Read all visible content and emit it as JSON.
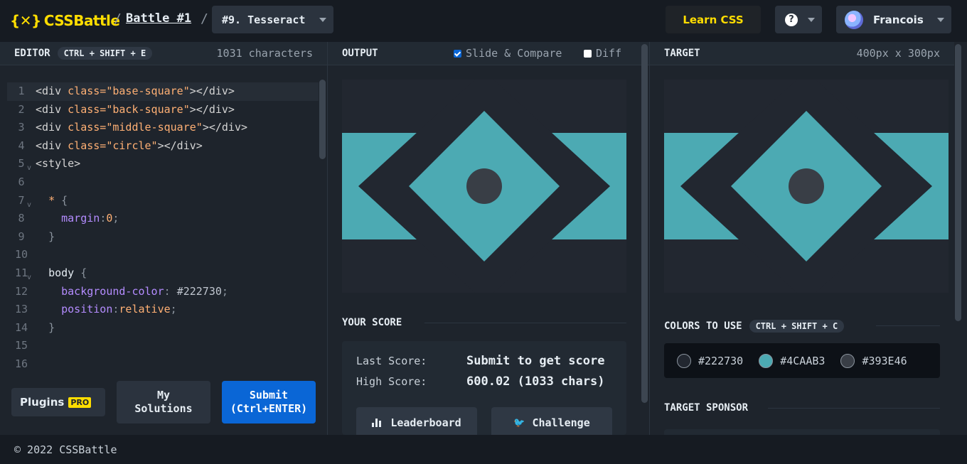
{
  "app": {
    "logo_text": "CSSBattle",
    "battle_link": "Battle #1",
    "target_title": "#9. Tesseract",
    "learn_label": "Learn CSS",
    "help_label": "?",
    "user_name": "Francois"
  },
  "editor": {
    "title": "EDITOR",
    "shortcut": "CTRL + SHIFT + E",
    "char_count": "1031 characters",
    "lines": [
      {
        "n": "1",
        "fold": false,
        "active": true,
        "tokens": [
          [
            "tag",
            "<div "
          ],
          [
            "attr",
            "class="
          ],
          [
            "str",
            "\"base-square\""
          ],
          [
            "tag",
            "></div>"
          ]
        ]
      },
      {
        "n": "2",
        "fold": false,
        "active": false,
        "tokens": [
          [
            "tag",
            "<div "
          ],
          [
            "attr",
            "class="
          ],
          [
            "str",
            "\"back-square\""
          ],
          [
            "tag",
            "></div>"
          ]
        ]
      },
      {
        "n": "3",
        "fold": false,
        "active": false,
        "tokens": [
          [
            "tag",
            "<div "
          ],
          [
            "attr",
            "class="
          ],
          [
            "str",
            "\"middle-square\""
          ],
          [
            "tag",
            "></div>"
          ]
        ]
      },
      {
        "n": "4",
        "fold": false,
        "active": false,
        "tokens": [
          [
            "tag",
            "<div "
          ],
          [
            "attr",
            "class="
          ],
          [
            "str",
            "\"circle\""
          ],
          [
            "tag",
            "></div>"
          ]
        ]
      },
      {
        "n": "5",
        "fold": true,
        "active": false,
        "tokens": [
          [
            "tag",
            "<style>"
          ]
        ]
      },
      {
        "n": "6",
        "fold": false,
        "active": false,
        "tokens": []
      },
      {
        "n": "7",
        "fold": true,
        "active": false,
        "tokens": [
          [
            "plain",
            "  "
          ],
          [
            "star",
            "*"
          ],
          [
            "punc",
            " {"
          ]
        ]
      },
      {
        "n": "8",
        "fold": false,
        "active": false,
        "tokens": [
          [
            "plain",
            "    "
          ],
          [
            "prop",
            "margin"
          ],
          [
            "punc",
            ":"
          ],
          [
            "val",
            "0"
          ],
          [
            "punc",
            ";"
          ]
        ]
      },
      {
        "n": "9",
        "fold": false,
        "active": false,
        "tokens": [
          [
            "plain",
            "  "
          ],
          [
            "punc",
            "}"
          ]
        ]
      },
      {
        "n": "10",
        "fold": false,
        "active": false,
        "tokens": []
      },
      {
        "n": "11",
        "fold": true,
        "active": false,
        "tokens": [
          [
            "plain",
            "  "
          ],
          [
            "sel",
            "body"
          ],
          [
            "punc",
            " {"
          ]
        ]
      },
      {
        "n": "12",
        "fold": false,
        "active": false,
        "tokens": [
          [
            "plain",
            "    "
          ],
          [
            "prop",
            "background-color"
          ],
          [
            "punc",
            ": "
          ],
          [
            "hex",
            "#222730"
          ],
          [
            "punc",
            ";"
          ]
        ]
      },
      {
        "n": "13",
        "fold": false,
        "active": false,
        "tokens": [
          [
            "plain",
            "    "
          ],
          [
            "prop",
            "position"
          ],
          [
            "punc",
            ":"
          ],
          [
            "val",
            "relative"
          ],
          [
            "punc",
            ";"
          ]
        ]
      },
      {
        "n": "14",
        "fold": false,
        "active": false,
        "tokens": [
          [
            "plain",
            "  "
          ],
          [
            "punc",
            "}"
          ]
        ]
      },
      {
        "n": "15",
        "fold": false,
        "active": false,
        "tokens": []
      },
      {
        "n": "16",
        "fold": false,
        "active": false,
        "tokens": []
      }
    ],
    "plugins_label": "Plugins",
    "pro_badge": "PRO",
    "my_solutions_label": "My Solutions",
    "submit_label": "Submit",
    "submit_shortcut": "(Ctrl+ENTER)"
  },
  "output": {
    "title": "OUTPUT",
    "slide_label": "Slide & Compare",
    "slide_checked": true,
    "diff_label": "Diff",
    "diff_checked": false
  },
  "score": {
    "title": "YOUR SCORE",
    "last_label": "Last Score:",
    "last_value": "Submit to get score",
    "high_label": "High Score:",
    "high_value": "600.02 (1033 chars)",
    "leaderboard_label": "Leaderboard",
    "challenge_label": "Challenge"
  },
  "target": {
    "title": "TARGET",
    "size": "400px x 300px",
    "colors_title": "COLORS TO USE",
    "colors_shortcut": "CTRL + SHIFT + C",
    "colors": [
      {
        "hex": "#222730"
      },
      {
        "hex": "#4CAAB3"
      },
      {
        "hex": "#393E46"
      }
    ],
    "sponsor_title": "TARGET SPONSOR"
  },
  "footer": {
    "copyright": "© 2022 CSSBattle"
  },
  "palette": {
    "bg": "#222730",
    "teal": "#4CAAB3",
    "dot": "#393E46",
    "accent": "#ffdd00",
    "primary": "#0a66d6"
  }
}
